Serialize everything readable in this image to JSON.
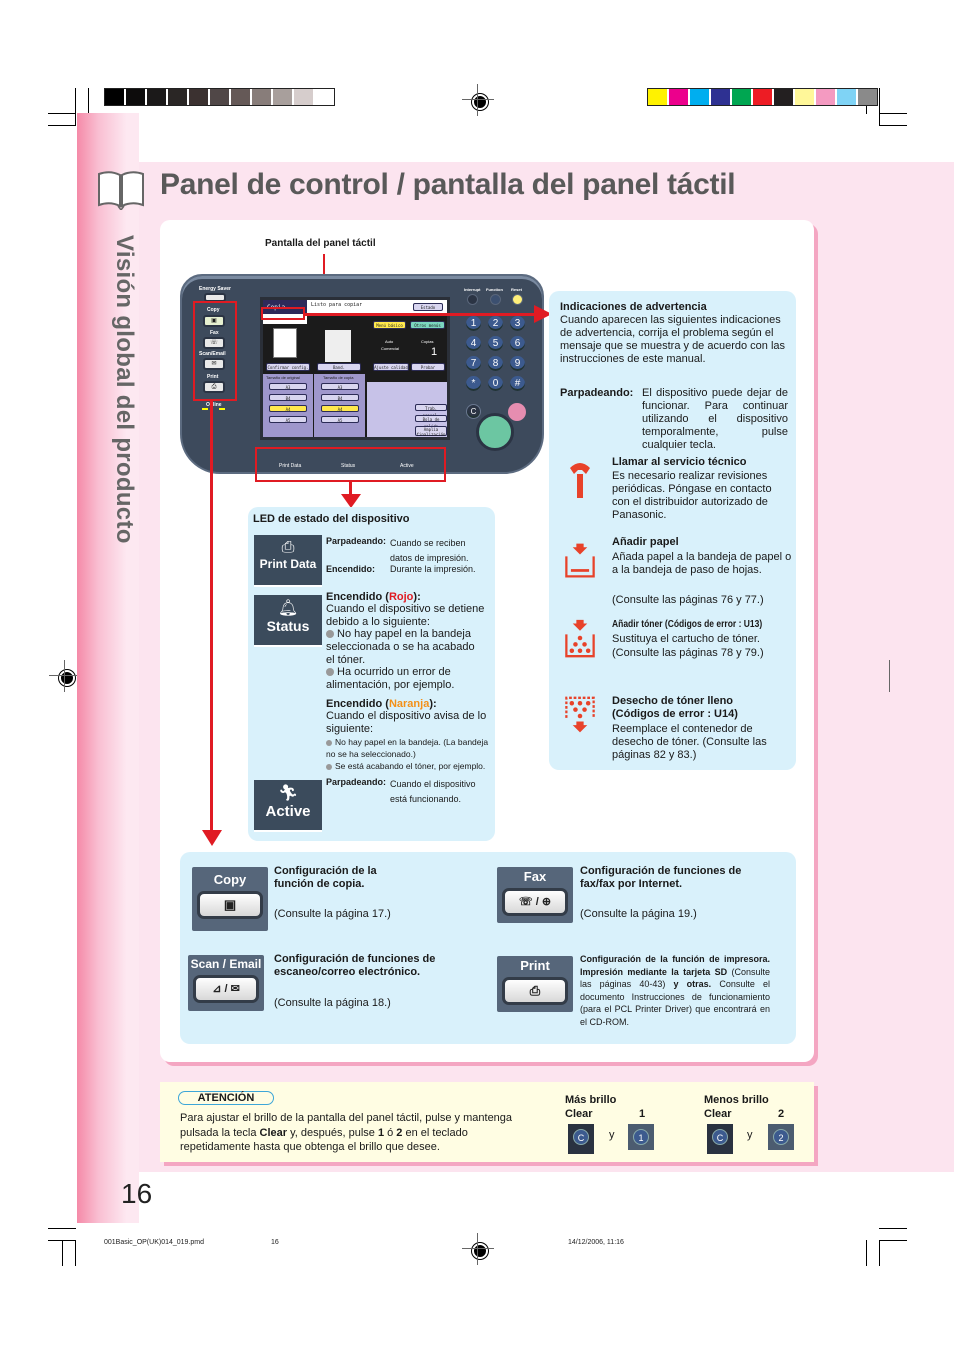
{
  "header": {
    "title": "Panel de control / pantalla del panel táctil",
    "side_title": "Visión global del producto",
    "gray_bar_colors": [
      "#000000",
      "#0d0c0c",
      "#1b1919",
      "#2a2625",
      "#3b3130",
      "#504747",
      "#655957",
      "#887d7a",
      "#a89f9c",
      "#d6cdcc",
      "#ffffff"
    ],
    "color_bar_colors": [
      "#fff200",
      "#ec008c",
      "#00aeef",
      "#2e3192",
      "#00a651",
      "#ed1c24",
      "#231f20",
      "#fff799",
      "#f49ac1",
      "#7fd3f5",
      "#8a8a8a"
    ]
  },
  "panel": {
    "screen_label": "Pantalla del panel táctil",
    "left_buttons": [
      {
        "label": "Energy Saver"
      },
      {
        "label": "Copy"
      },
      {
        "label": "Fax"
      },
      {
        "label": "Scan/Email"
      },
      {
        "label": "Print"
      }
    ],
    "online_label": "Online",
    "top_right_buttons": [
      "Interrupt",
      "Function",
      "Reset"
    ],
    "keypad": [
      "1",
      "2",
      "3",
      "4",
      "5",
      "6",
      "7",
      "8",
      "9",
      "*",
      "0",
      "#"
    ],
    "clear_key": "C",
    "leds": [
      "Print Data",
      "Status",
      "Active"
    ],
    "screen": {
      "tab": "Copia",
      "status": "Listo para copiar",
      "estado_btn": "Estado",
      "menu_basico": "Menú básico",
      "otros_menus": "Otros menús",
      "auto": "Auto",
      "copias_label": "Copias",
      "copias_value": "1",
      "comercial": "Comercial",
      "confirmar": "Confirmar config.",
      "band": "Band. papel/salida",
      "ajuste": "Ajuste calidad",
      "probar": "Probar",
      "tam_original": "Tamaño de original",
      "tam_copia": "Tamaño de copia",
      "sizes": [
        "A3",
        "B4",
        "A4",
        "A5"
      ],
      "trab": "Trab. presel.",
      "bola": "Bola de salida",
      "ampl": "Amplia finalización"
    }
  },
  "warnings": {
    "title": "Indicaciones de advertencia",
    "intro": "Cuando aparecen las siguientes indicaciones de advertencia, corrija el problema según el mensaje que se muestra y de acuerdo con las instrucciones de este manual.",
    "blink_label": "Parpadeando:",
    "blink_text": "El dispositivo puede dejar de funcionar. Para continuar utilizando el dispositivo temporalmente, pulse cualquier tecla.",
    "items": [
      {
        "icon": "wrench-icon",
        "title": "Llamar al servicio técnico",
        "text": "Es necesario realizar revisiones periódicas. Póngase en contacto con el distribuidor autorizado de Panasonic."
      },
      {
        "icon": "add-paper-icon",
        "title": "Añadir papel",
        "text": "Añada papel a la bandeja de papel o a la bandeja de paso de hojas.",
        "ref": "(Consulte las páginas 76 y 77.)"
      },
      {
        "icon": "add-toner-icon",
        "title": "Añadir tóner (Códigos de error : U13)",
        "text": "Sustituya el cartucho de tóner.",
        "ref": "(Consulte las páginas 78 y 79.)"
      },
      {
        "icon": "waste-toner-icon",
        "title": "Desecho de tóner lleno (Códigos de error : U14)",
        "text": "Reemplace el contenedor de desecho de tóner. (Consulte las páginas 82 y 83.)"
      }
    ]
  },
  "led_status": {
    "title": "LED de estado del dispositivo",
    "print_data": {
      "name": "Print Data",
      "blink_label": "Parpadeando:",
      "blink_text": "Cuando se reciben datos de impresión.",
      "on_label": "Encendido:",
      "on_text": "Durante la impresión."
    },
    "status": {
      "name": "Status",
      "red_heading_pre": "Encendido (",
      "red_word": "Rojo",
      "heading_post": "):",
      "red_text": "Cuando el dispositivo se detiene debido a lo siguiente:",
      "red_bullets": [
        "No hay papel en la bandeja seleccionada o se ha acabado el tóner.",
        "Ha ocurrido un error de alimentación, por ejemplo."
      ],
      "orange_word": "Naranja",
      "orange_text": "Cuando el dispositivo avisa de lo siguiente:",
      "orange_bullets": [
        "No hay papel en la bandeja. (La bandeja no se ha seleccionado.)",
        "Se está acabando el tóner, por ejemplo."
      ]
    },
    "active": {
      "name": "Active",
      "blink_label": "Parpadeando:",
      "blink_text": "Cuando el dispositivo está funcionando."
    }
  },
  "functions": [
    {
      "label": "Copy",
      "icon_text": "▣",
      "title": "Configuración de la función de copia.",
      "ref": "(Consulte la página 17.)"
    },
    {
      "label": "Fax",
      "icon_text": "☏ / ⊕",
      "title": "Configuración de funciones de fax/fax por Internet.",
      "ref": "(Consulte la página 19.)"
    },
    {
      "label": "Scan / Email",
      "icon_text": "⊿ / ✉",
      "title": "Configuración de funciones de escaneo/correo electrónico.",
      "ref": "(Consulte la página 18.)"
    },
    {
      "label": "Print",
      "icon_text": "⎙",
      "title": "Configuración de la función de impresora.",
      "title2": "Impresión mediante la tarjeta SD",
      "ref_mid": " (Consulte las páginas 40-43) ",
      "title3": "y otras.",
      "ref": "Consulte el documento Instrucciones de funcionamiento (para el PCL Printer Driver) que encontrará en el CD-ROM."
    }
  ],
  "attention": {
    "label": "ATENCIÓN",
    "text_1": "Para ajustar el brillo de la pantalla del panel táctil, pulse y mantenga pulsada la tecla ",
    "clear": "Clear",
    "text_2": " y, después, pulse ",
    "k1": "1",
    "text_3": " ó ",
    "k2": "2",
    "text_4": " en el teclado repetidamente hasta que obtenga el brillo que desee.",
    "more": {
      "title": "Más brillo",
      "key_a": "Clear",
      "key_b": "1",
      "and": "y"
    },
    "less": {
      "title": "Menos brillo",
      "key_a": "Clear",
      "key_b": "2",
      "and": "y"
    },
    "c_key": "C"
  },
  "page_number": "16",
  "footer": {
    "file": "001Basic_OP(UK)014_019.pmd",
    "page": "16",
    "date": "14/12/2006, 11:16"
  }
}
